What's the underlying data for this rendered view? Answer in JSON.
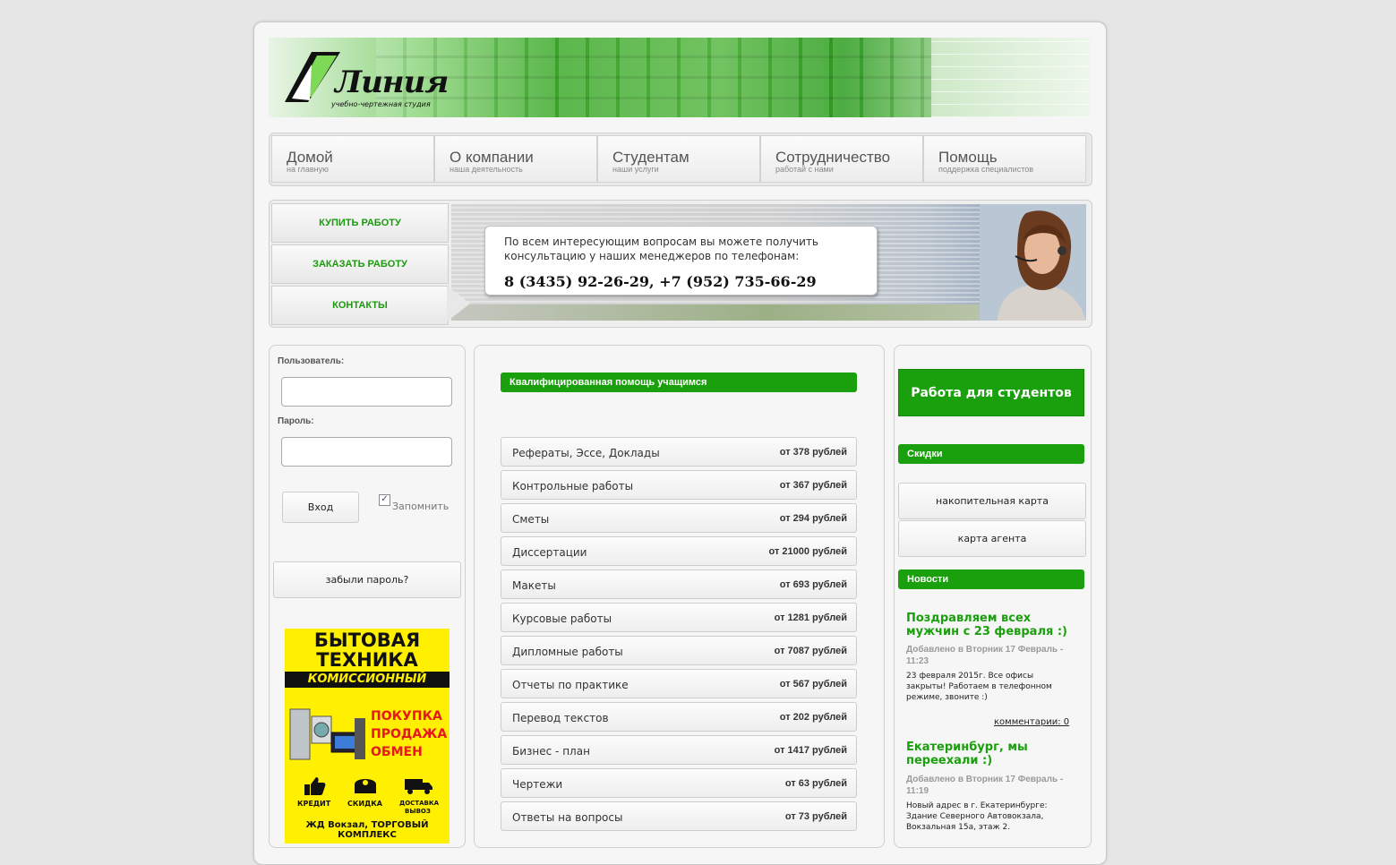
{
  "logo": {
    "name": "Линия",
    "tagline": "учебно-чертежная студия"
  },
  "nav": [
    {
      "title": "Домой",
      "sub": "на главную"
    },
    {
      "title": "О компании",
      "sub": "наша деятельность"
    },
    {
      "title": "Студентам",
      "sub": "наши услуги"
    },
    {
      "title": "Сотрудничество",
      "sub": "работай с нами"
    },
    {
      "title": "Помощь",
      "sub": "поддержка специалистов"
    }
  ],
  "side_buttons": [
    "КУПИТЬ РАБОТУ",
    "ЗАКАЗАТЬ РАБОТУ",
    "КОНТАКТЫ"
  ],
  "contact": {
    "text": "По всем интересующим вопросам вы можете получить консультацию у наших менеджеров по телефонам:",
    "phones": "8 (3435) 92-26-29, +7 (952) 735-66-29"
  },
  "login": {
    "user_label": "Пользователь:",
    "pass_label": "Пароль:",
    "submit": "Вход",
    "remember": "Запомнить",
    "remember_checked": true,
    "forgot": "забыли пароль?"
  },
  "ad": {
    "line1": "БЫТОВАЯ",
    "line2": "ТЕХНИКА",
    "line3": "КОМИССИОННЫЙ",
    "services": [
      "ПОКУПКА",
      "ПРОДАЖА",
      "ОБМЕН"
    ],
    "icons": [
      "КРЕДИТ",
      "СКИДКА",
      "ДОСТАВКА",
      "ВЫВОЗ"
    ],
    "footer": "ЖД Вокзал, ТОРГОВЫЙ КОМПЛЕКС"
  },
  "services_header": "Квалифицированная помощь учащимся",
  "services": [
    {
      "name": "Рефераты, Эссе, Доклады",
      "price": "от 378 рублей"
    },
    {
      "name": "Контрольные работы",
      "price": "от 367 рублей"
    },
    {
      "name": "Сметы",
      "price": "от 294 рублей"
    },
    {
      "name": "Диссертации",
      "price": "от 21000 рублей"
    },
    {
      "name": "Макеты",
      "price": "от 693 рублей"
    },
    {
      "name": "Курсовые работы",
      "price": "от 1281 рублей"
    },
    {
      "name": "Дипломные работы",
      "price": "от 7087 рублей"
    },
    {
      "name": "Отчеты по практике",
      "price": "от 567 рублей"
    },
    {
      "name": "Перевод текстов",
      "price": "от 202 рублей"
    },
    {
      "name": "Бизнес - план",
      "price": "от 1417 рублей"
    },
    {
      "name": "Чертежи",
      "price": "от 63 рублей"
    },
    {
      "name": "Ответы на вопросы",
      "price": "от 73 рублей"
    }
  ],
  "right": {
    "work_button": "Работа для студентов",
    "discounts_header": "Скидки",
    "discounts": [
      "накопительная карта",
      "карта агента"
    ],
    "news_header": "Новости",
    "news": [
      {
        "title": "Поздравляем всех мужчин с 23 февраля :)",
        "meta": "Добавлено в Вторник 17 Февраль - 11:23",
        "body": "23 февраля 2015г. Все офисы закрыты! Работаем в телефонном режиме, звоните :)",
        "comments": "комментарии: 0"
      },
      {
        "title": "Екатеринбург, мы переехали :)",
        "meta": "Добавлено в Вторник 17 Февраль - 11:19",
        "body": "Новый адрес в г. Екатеринбурге: Здание Северного Автовокзала, Вокзальная 15а, этаж 2."
      }
    ]
  },
  "colors": {
    "accent": "#1a9f0d",
    "page_bg": "#e6e6e6"
  }
}
